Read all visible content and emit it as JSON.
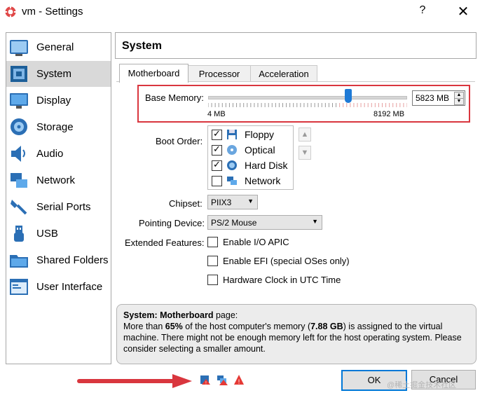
{
  "window": {
    "title": "vm - Settings",
    "help_label": "?",
    "close_label": "✕"
  },
  "sidebar": {
    "items": [
      {
        "label": "General",
        "icon": "general-icon"
      },
      {
        "label": "System",
        "icon": "system-icon",
        "selected": true
      },
      {
        "label": "Display",
        "icon": "display-icon"
      },
      {
        "label": "Storage",
        "icon": "storage-icon"
      },
      {
        "label": "Audio",
        "icon": "audio-icon"
      },
      {
        "label": "Network",
        "icon": "network-icon"
      },
      {
        "label": "Serial Ports",
        "icon": "serial-ports-icon"
      },
      {
        "label": "USB",
        "icon": "usb-icon"
      },
      {
        "label": "Shared Folders",
        "icon": "shared-folders-icon"
      },
      {
        "label": "User Interface",
        "icon": "user-interface-icon"
      }
    ]
  },
  "header": {
    "title": "System"
  },
  "tabs": [
    {
      "label": "Motherboard",
      "active": true
    },
    {
      "label": "Processor"
    },
    {
      "label": "Acceleration"
    }
  ],
  "motherboard": {
    "memory": {
      "label": "Base Memory:",
      "value": "5823 MB",
      "min_label": "4 MB",
      "max_label": "8192 MB",
      "fraction": 0.71
    },
    "boot_order": {
      "label": "Boot Order:",
      "items": [
        {
          "label": "Floppy",
          "checked": true,
          "icon": "floppy-icon"
        },
        {
          "label": "Optical",
          "checked": true,
          "icon": "optical-icon"
        },
        {
          "label": "Hard Disk",
          "checked": true,
          "icon": "hard-disk-icon"
        },
        {
          "label": "Network",
          "checked": false,
          "icon": "network-icon"
        }
      ]
    },
    "chipset": {
      "label": "Chipset:",
      "value": "PIIX3"
    },
    "pointing": {
      "label": "Pointing Device:",
      "value": "PS/2 Mouse"
    },
    "extended": {
      "label": "Extended Features:",
      "options": [
        {
          "label": "Enable I/O APIC",
          "checked": false
        },
        {
          "label": "Enable EFI (special OSes only)",
          "checked": false
        },
        {
          "label": "Hardware Clock in UTC Time",
          "checked": false
        }
      ]
    }
  },
  "info": {
    "title": "System: Motherboard",
    "title_suffix": " page:",
    "line1_a": "More than ",
    "line1_b": "65%",
    "line1_c": " of the host computer's memory (",
    "line1_d": "7.88 GB",
    "line1_e": ") is assigned to the virtual machine. There might not be enough memory left for the host operating system. Please consider selecting a smaller amount."
  },
  "buttons": {
    "ok": "OK",
    "cancel": "Cancel"
  },
  "watermark": "@稀土掘金技术社区",
  "colors": {
    "highlight": "#d9363e",
    "accent": "#0078d7",
    "slider": "#1e7ad6"
  }
}
